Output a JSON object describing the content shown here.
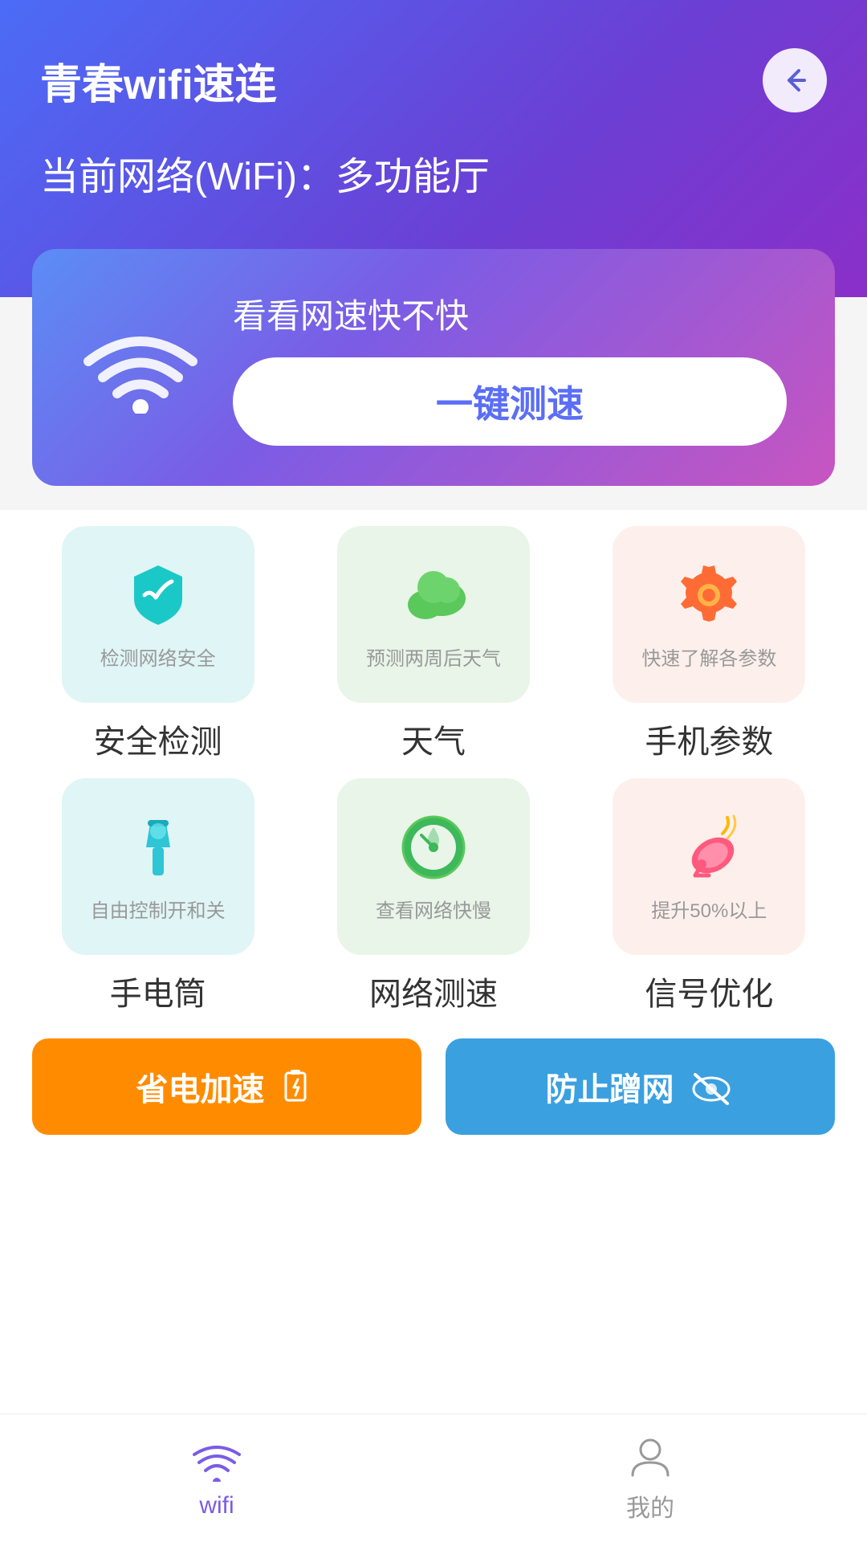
{
  "header": {
    "title": "青春wifi速连",
    "back_icon": "←",
    "current_network_label": "当前网络(WiFi)：多功能厅"
  },
  "speed_card": {
    "description": "看看网速快不快",
    "button_label": "一键测速"
  },
  "features_row1": [
    {
      "id": "security",
      "card_color": "blue",
      "desc": "检测网络安全",
      "name": "安全检测"
    },
    {
      "id": "weather",
      "card_color": "green",
      "desc": "预测两周后天气",
      "name": "天气"
    },
    {
      "id": "phone-params",
      "card_color": "peach",
      "desc": "快速了解各参数",
      "name": "手机参数"
    }
  ],
  "features_row2": [
    {
      "id": "torch",
      "card_color": "blue",
      "desc": "自由控制开和关",
      "name": "手电筒"
    },
    {
      "id": "network-speed",
      "card_color": "green",
      "desc": "查看网络快慢",
      "name": "网络测速"
    },
    {
      "id": "signal",
      "card_color": "peach",
      "desc": "提升50%以上",
      "name": "信号优化"
    }
  ],
  "bottom_cards": [
    {
      "id": "power-boost",
      "label": "省电加速",
      "color": "orange"
    },
    {
      "id": "anti-rub",
      "label": "防止蹭网",
      "color": "blue"
    }
  ],
  "bottom_nav": {
    "items": [
      {
        "id": "wifi",
        "label": "wifi",
        "active": true
      },
      {
        "id": "my",
        "label": "我的",
        "active": false
      }
    ]
  }
}
